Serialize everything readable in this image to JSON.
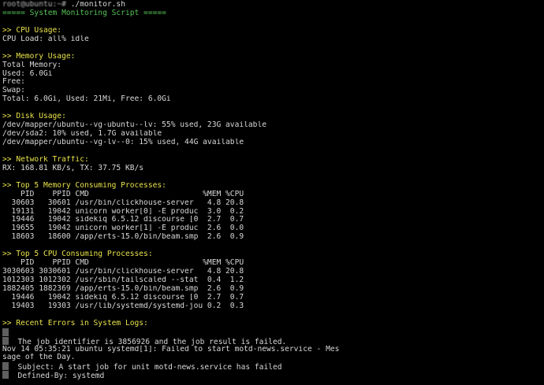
{
  "colors": {
    "background": "#000000",
    "text": "#d8d8d8",
    "header": "#e8e24a",
    "banner": "#55c255"
  },
  "prompt": {
    "user_host": "root@ubuntu:~#",
    "command": "./monitor.sh"
  },
  "banner": "===== System Monitoring Script =====",
  "cpu": {
    "header": ">> CPU Usage:",
    "line": "CPU Load: all% idle"
  },
  "memory": {
    "header": ">> Memory Usage:",
    "total": "Total Memory: ",
    "used": "Used: 6.0Gi",
    "free": "Free: ",
    "swap": "Swap:",
    "summary": "Total: 6.0Gi, Used: 21Mi, Free: 6.0Gi"
  },
  "disk": {
    "header": ">> Disk Usage:",
    "lines": [
      "/dev/mapper/ubuntu--vg-ubuntu--lv: 55% used, 23G available",
      "/dev/sda2: 10% used, 1.7G available",
      "/dev/mapper/ubuntu--vg-lv--0: 15% used, 44G available"
    ]
  },
  "network": {
    "header": ">> Network Traffic:",
    "line": "RX: 168.81 KB/s, TX: 37.75 KB/s"
  },
  "mem_procs": {
    "header": ">> Top 5 Memory Consuming Processes:",
    "col_header": "    PID    PPID CMD                         %MEM %CPU",
    "rows": [
      "  30603   30601 /usr/bin/clickhouse-server   4.8 20.8",
      "  19131   19042 unicorn worker[0] -E produc  3.0  0.2",
      "  19446   19042 sidekiq 6.5.12 discourse [0  2.7  0.7",
      "  19655   19042 unicorn worker[1] -E produc  2.6  0.0",
      "  18603   18600 /app/erts-15.0/bin/beam.smp  2.6  0.9"
    ]
  },
  "cpu_procs": {
    "header": ">> Top 5 CPU Consuming Processes:",
    "col_header": "    PID    PPID CMD                         %MEM %CPU",
    "rows": [
      "3030603 3030601 /usr/bin/clickhouse-server   4.8 20.8",
      "1012303 1012302 /usr/sbin/tailscaled --stat  0.4  1.2",
      "1882405 1882369 /app/erts-15.0/bin/beam.smp  2.6  0.9",
      "  19446   19042 sidekiq 6.5.12 discourse [0  2.7  0.7",
      "  19403   19303 /usr/lib/systemd/systemd-jou 0.2  0.3"
    ]
  },
  "logs": {
    "header": ">> Recent Errors in System Logs:",
    "lines": [
      "",
      "  The job identifier is 3856926 and the job result is failed.",
      "Nov 14 05:35:21 ubuntu systemd[1]: Failed to start motd-news.service - Mes",
      "sage of the Day.",
      "  Subject: A start job for unit motd-news.service has failed",
      "  Defined-By: systemd"
    ]
  }
}
